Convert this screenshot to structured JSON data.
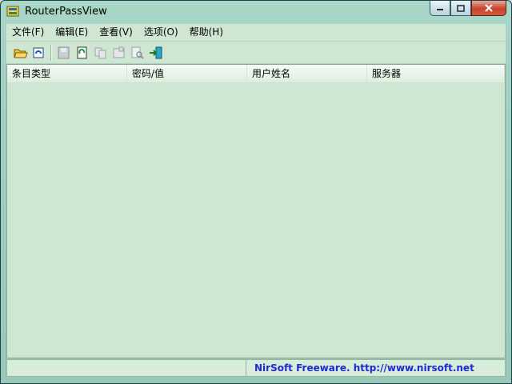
{
  "window": {
    "title": "RouterPassView"
  },
  "menu": {
    "items": [
      "文件(F)",
      "编辑(E)",
      "查看(V)",
      "选项(O)",
      "帮助(H)"
    ]
  },
  "toolbar": {
    "icons": [
      "open-icon",
      "refresh-file-icon",
      "save-icon",
      "reload-icon",
      "copy-icon",
      "properties-icon",
      "find-icon",
      "exit-icon"
    ]
  },
  "list": {
    "columns": [
      "条目类型",
      "密码/值",
      "用户姓名",
      "服务器"
    ]
  },
  "statusbar": {
    "left": "",
    "right": "NirSoft Freeware.  http://www.nirsoft.net"
  },
  "colors": {
    "background": "#cfe7d2",
    "link": "#1c2bd6"
  }
}
